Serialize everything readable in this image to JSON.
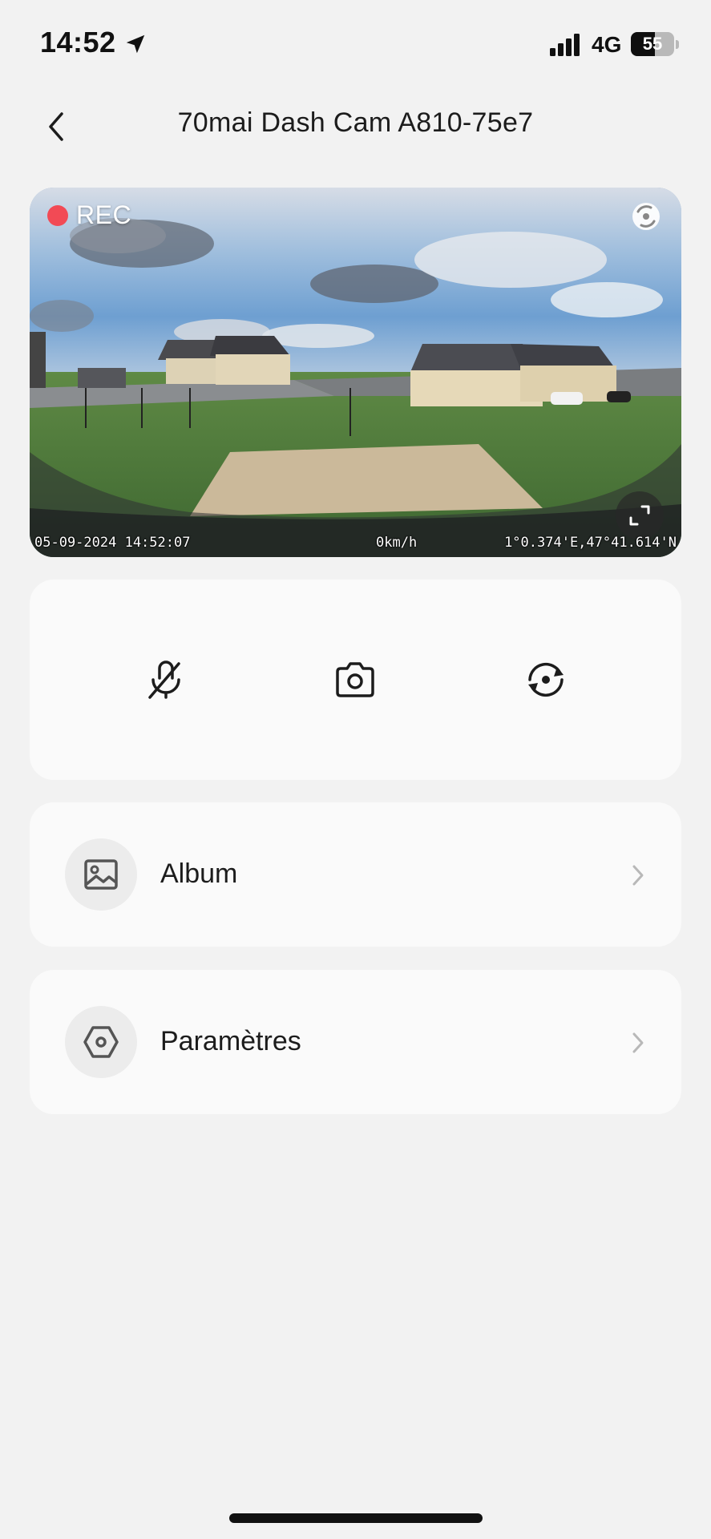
{
  "status_bar": {
    "time": "14:52",
    "network": "4G",
    "battery_level": "55",
    "battery_fraction": 0.55
  },
  "header": {
    "title": "70mai Dash Cam A810-75e7",
    "back_icon": "chevron-left-icon"
  },
  "preview": {
    "rec_label": "REC",
    "rec_color": "#f24a55",
    "date_time": "05-09-2024 14:52:07",
    "speed": "0km/h",
    "coordinates": "1°0.374'E,47°41.614'N",
    "gps_icon": "gps-signal-icon",
    "fullscreen_icon": "expand-icon"
  },
  "controls": [
    {
      "name": "mute-microphone",
      "icon": "microphone-off-icon"
    },
    {
      "name": "snapshot",
      "icon": "camera-icon"
    },
    {
      "name": "switch-camera",
      "icon": "switch-camera-icon"
    }
  ],
  "menu": {
    "album_label": "Album",
    "album_icon": "image-icon",
    "settings_label": "Paramètres",
    "settings_icon": "hexagon-settings-icon",
    "chevron_icon": "chevron-right-icon"
  }
}
